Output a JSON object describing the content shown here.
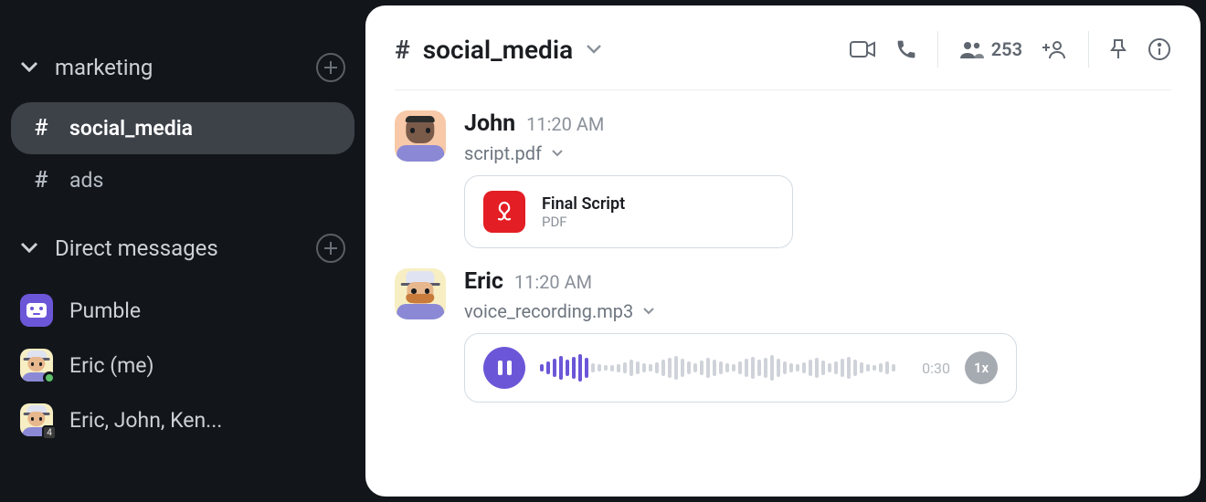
{
  "sidebar": {
    "sections": [
      {
        "label": "marketing"
      },
      {
        "label": "Direct messages"
      }
    ],
    "channels": [
      {
        "name": "social_media",
        "active": true
      },
      {
        "name": "ads",
        "active": false
      }
    ],
    "dms": [
      {
        "name": "Pumble"
      },
      {
        "name": "Eric (me)"
      },
      {
        "name": "Eric, John, Ken..."
      }
    ],
    "multi_badge": "4"
  },
  "header": {
    "channel_name": "social_media",
    "member_count": "253"
  },
  "messages": [
    {
      "author": "John",
      "time": "11:20 AM",
      "file_label": "script.pdf",
      "attachment": {
        "title": "Final Script",
        "type": "PDF"
      }
    },
    {
      "author": "Eric",
      "time": "11:20 AM",
      "file_label": "voice_recording.mp3",
      "audio": {
        "duration": "0:30",
        "speed": "1x"
      }
    }
  ]
}
